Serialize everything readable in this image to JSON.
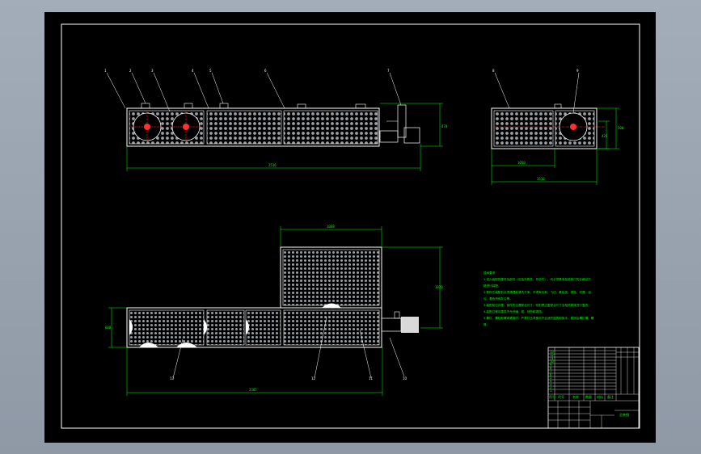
{
  "colors": {
    "background": "#8f99a6",
    "sheet": "#000000",
    "outline": "#ffffff",
    "dimension": "#00ff00",
    "centerline": "#ff2a2a",
    "hole": "#9aa0a6"
  },
  "views": {
    "front": {
      "balloons": [
        "1",
        "2",
        "3",
        "4",
        "5",
        "6",
        "7"
      ],
      "dim_height": "470",
      "dim_length": "2516"
    },
    "side": {
      "balloons": [
        "8",
        "9"
      ],
      "dim_height_outer": "500",
      "dim_height_inner": "425",
      "dim_width_inner": "1050",
      "dim_width_outer": "1510"
    },
    "plan": {
      "balloons": [
        "10",
        "11",
        "12",
        "13"
      ],
      "dim_top_width": "1068",
      "dim_right_height": "1020",
      "dim_left_height": "600",
      "dim_bottom_length": "2365"
    }
  },
  "notes": {
    "title": "技术要求",
    "lines": [
      "1.进入装配的零件及部件（包括外购件、外协件），均必须具有检验部门的合格证方",
      "能进行装配。",
      "2.零件在装配前必须清理和清洗干净，不得有毛刺、飞边、氧化皮、锈蚀、切屑、油",
      "污、着色剂和灰尘等。",
      "3.装配前应对零、部件的主要配合尺寸，特别是过盈配合尺寸及相关精度进行复查。",
      "4.装配过程中零件不允许磕、碰、划伤和锈蚀。",
      "5.螺钉、螺栓和螺母紧固时，严禁打击或使用不合适的旋具和扳手。紧固后螺钉槽、螺",
      "母。"
    ]
  },
  "title_block": {
    "parts_rows": [
      "13",
      "12",
      "11",
      "10",
      "9",
      "8",
      "7",
      "6",
      "5",
      "4",
      "3",
      "2",
      "1"
    ],
    "header": [
      "序号",
      "代号",
      "名称",
      "数量",
      "材料",
      "备注"
    ],
    "drawing_name": "总装图"
  }
}
